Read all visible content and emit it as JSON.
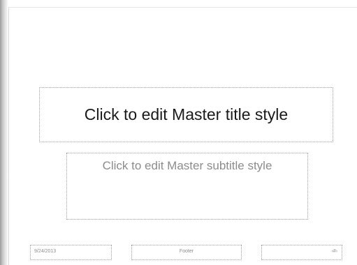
{
  "slide": {
    "title_placeholder": "Click to edit Master title style",
    "subtitle_placeholder": "Click to edit Master subtitle style",
    "date": "9/24/2013",
    "footer": "Footer",
    "slide_number": "‹#›"
  }
}
